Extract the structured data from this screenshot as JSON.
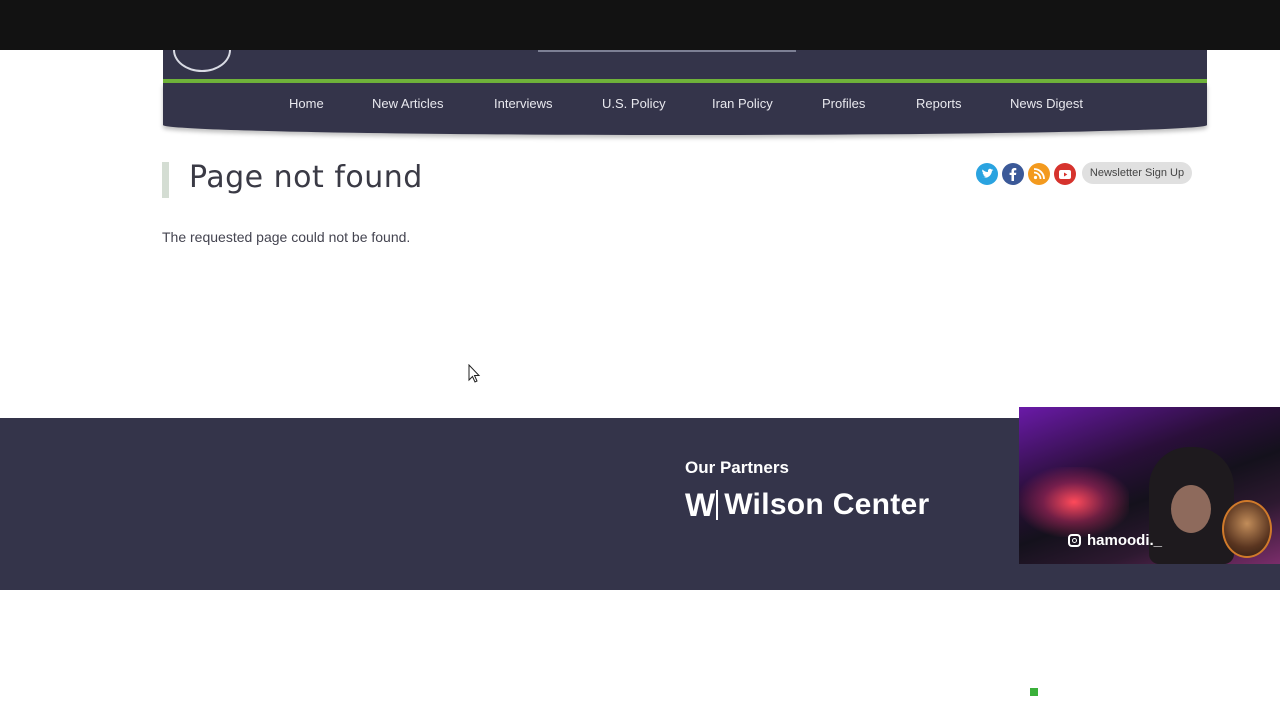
{
  "nav": {
    "items": [
      {
        "label": "Home"
      },
      {
        "label": "New Articles"
      },
      {
        "label": "Interviews"
      },
      {
        "label": "U.S. Policy"
      },
      {
        "label": "Iran Policy"
      },
      {
        "label": "Profiles"
      },
      {
        "label": "Reports"
      },
      {
        "label": "News Digest"
      }
    ]
  },
  "main": {
    "title": "Page not found",
    "message": "The requested page could not be found."
  },
  "social": {
    "icons": [
      "twitter-icon",
      "facebook-icon",
      "rss-icon",
      "youtube-icon"
    ],
    "newsletter_label": "Newsletter Sign Up"
  },
  "footer": {
    "partners_label": "Our Partners",
    "partner_name": "Wilson Center"
  },
  "overlay": {
    "webcam_handle": "hamoodi._"
  },
  "colors": {
    "header": "#34344a",
    "accent_green": "#6fb33a",
    "footer": "#34344a"
  }
}
